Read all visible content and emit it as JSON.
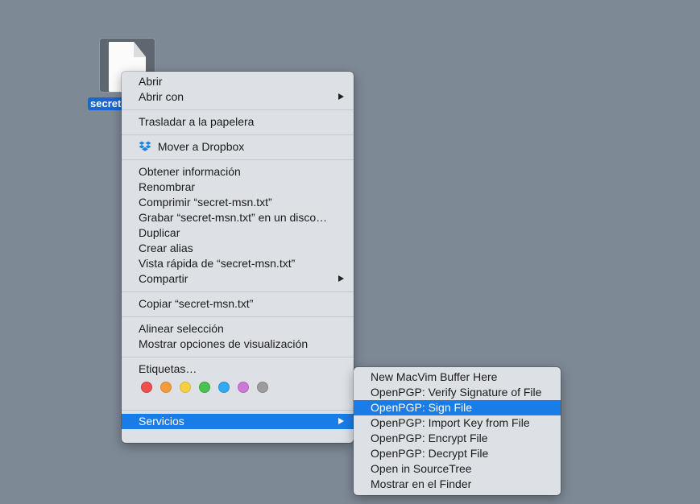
{
  "desktop": {
    "file_label": "secret-msn.txt"
  },
  "context_menu": {
    "open": "Abrir",
    "open_with": "Abrir con",
    "move_to_trash": "Trasladar a la papelera",
    "move_to_dropbox": "Mover a Dropbox",
    "get_info": "Obtener información",
    "rename": "Renombrar",
    "compress": "Comprimir “secret-msn.txt”",
    "burn": "Grabar “secret-msn.txt” en un disco…",
    "duplicate": "Duplicar",
    "make_alias": "Crear alias",
    "quick_look": "Vista rápida de “secret-msn.txt”",
    "share": "Compartir",
    "copy": "Copiar “secret-msn.txt”",
    "align_selection": "Alinear selección",
    "show_view_options": "Mostrar opciones de visualización",
    "tags": "Etiquetas…",
    "tag_colors": [
      {
        "name": "red",
        "fill": "#ee4f4f",
        "stroke": "#d13c3c"
      },
      {
        "name": "orange",
        "fill": "#f49c3b",
        "stroke": "#dc8729"
      },
      {
        "name": "yellow",
        "fill": "#f5cf44",
        "stroke": "#dcb832"
      },
      {
        "name": "green",
        "fill": "#4cc152",
        "stroke": "#3aa641"
      },
      {
        "name": "blue",
        "fill": "#35a9f0",
        "stroke": "#2591d8"
      },
      {
        "name": "purple",
        "fill": "#cd78d6",
        "stroke": "#b665c0"
      },
      {
        "name": "gray",
        "fill": "#9c9c9c",
        "stroke": "#878787"
      }
    ],
    "services": "Servicios"
  },
  "services_menu": {
    "items": [
      "New MacVim Buffer Here",
      "OpenPGP: Verify Signature of File",
      "OpenPGP: Sign File",
      "OpenPGP: Import Key from File",
      "OpenPGP: Encrypt File",
      "OpenPGP: Decrypt File",
      "Open in SourceTree",
      "Mostrar en el Finder"
    ],
    "highlighted_index": 2
  },
  "colors": {
    "desktop": "#7e8996",
    "menu_bg": "#dde1e6",
    "highlight": "#1a7ce6",
    "dropbox": "#1a82e2"
  }
}
